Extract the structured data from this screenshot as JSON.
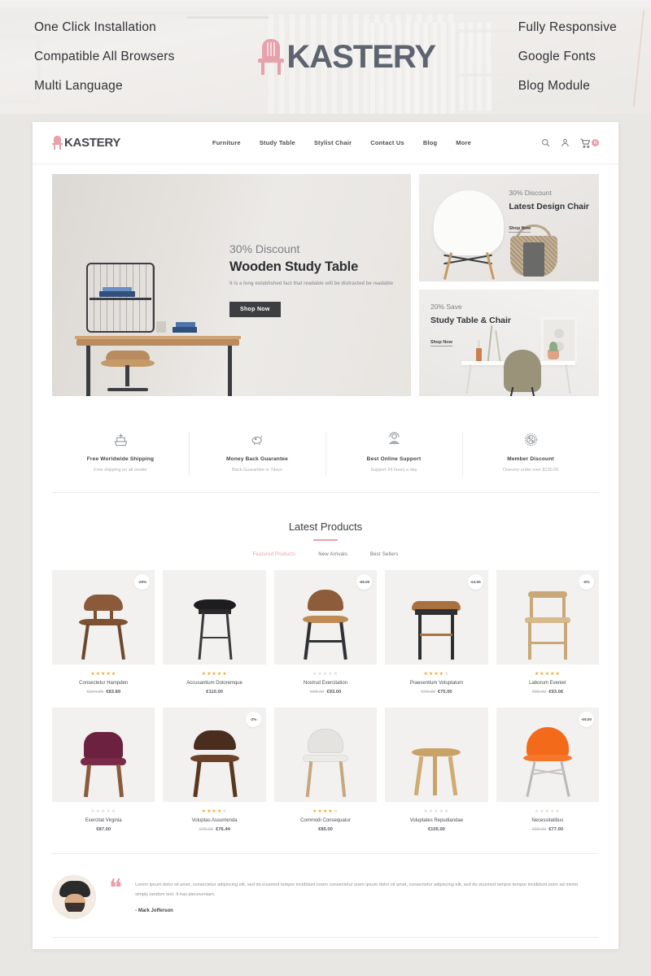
{
  "promo": {
    "left_features": [
      "One Click Installation",
      "Compatible All Browsers",
      "Multi Language"
    ],
    "right_features": [
      "Fully Responsive",
      "Google Fonts",
      "Blog Module"
    ],
    "logo_text": "KASTERY",
    "logo_icon": "chair-icon",
    "logo_color": "#e8a0ab",
    "logo_word_color": "#5d6470"
  },
  "header": {
    "brand": "Kastery",
    "nav": [
      {
        "label": "Furniture"
      },
      {
        "label": "Study Table"
      },
      {
        "label": "Stylist Chair"
      },
      {
        "label": "Contact Us"
      },
      {
        "label": "Blog"
      },
      {
        "label": "More"
      }
    ],
    "icons": [
      "search-icon",
      "user-icon",
      "cart-icon"
    ],
    "cart_count": "0"
  },
  "hero": {
    "main": {
      "discount": "30% Discount",
      "title": "Wooden Study Table",
      "subtitle": "It is a long established fact that readable will be distracted be  readable",
      "cta": "Shop Now"
    },
    "cards": [
      {
        "discount": "30% Discount",
        "title": "Latest Design Chair",
        "cta": "Shop Now"
      },
      {
        "discount": "20% Save",
        "title": "Study Table & Chair",
        "cta": "Shop Now"
      }
    ]
  },
  "services": [
    {
      "icon": "ship-icon",
      "title": "Free Worldwide Shipping",
      "sub": "Free shipping on all oreder"
    },
    {
      "icon": "piggy-bank-icon",
      "title": "Money Back Guarantee",
      "sub": "Back Guarantee in 7days"
    },
    {
      "icon": "headset-support-icon",
      "title": "Best Online Support",
      "sub": "Support 24 hours a day"
    },
    {
      "icon": "discount-percent-icon",
      "title": "Member Discount",
      "sub": "Onevery order over $130.00"
    }
  ],
  "products_section": {
    "title": "Latest Products",
    "accent": "#e8a0ab",
    "tabs": [
      {
        "label": "Featured Products",
        "active": true
      },
      {
        "label": "New Arrivals",
        "active": false
      },
      {
        "label": "Best Sellers",
        "active": false
      }
    ]
  },
  "products": [
    [
      {
        "name": "Consectetur Hampden",
        "rating": 5,
        "old_price": "€104.86",
        "price": "€83.89",
        "badge": "-20%"
      },
      {
        "name": "Accusantium Doloremque",
        "rating": 5,
        "old_price": "",
        "price": "€110.00",
        "badge": ""
      },
      {
        "name": "Nostrud Exercitation",
        "rating": 0,
        "old_price": "€98.00",
        "price": "€93.00",
        "badge": "-€5.00"
      },
      {
        "name": "Praesentium Voluptatum",
        "rating": 4,
        "old_price": "€79.00",
        "price": "€75.00",
        "badge": "-€4.00"
      },
      {
        "name": "Laborum Eveniet",
        "rating": 5,
        "old_price": "€99.00",
        "price": "€93.06",
        "badge": "-6%"
      }
    ],
    [
      {
        "name": "Exercitat Virginia",
        "rating": 0,
        "old_price": "",
        "price": "€87.00",
        "badge": ""
      },
      {
        "name": "Voluptas Assumenda",
        "rating": 4,
        "old_price": "€78.00",
        "price": "€76.44",
        "badge": "-2%"
      },
      {
        "name": "Commodi Consequatur",
        "rating": 4,
        "old_price": "",
        "price": "€85.00",
        "badge": ""
      },
      {
        "name": "Voluptates Repudiandae",
        "rating": 0,
        "old_price": "",
        "price": "€105.00",
        "badge": ""
      },
      {
        "name": "Necessitatibus",
        "rating": 0,
        "old_price": "€83.00",
        "price": "€77.00",
        "badge": "-€6.00"
      }
    ]
  ],
  "testimonial": {
    "quote_icon": "quote-icon",
    "text": "Lorem ipsum dolor sit amet, consectetur adipiscing elit, sed do eiusmod tempor incididunt lorem consectetur orem ipsum dolor sit amet, consectetur adipiscing elit, sed do eiusmod tempor tempor incididunt enim ad minim simply random text. It has pieceveniam.",
    "author": "- Mark Jofferson"
  }
}
